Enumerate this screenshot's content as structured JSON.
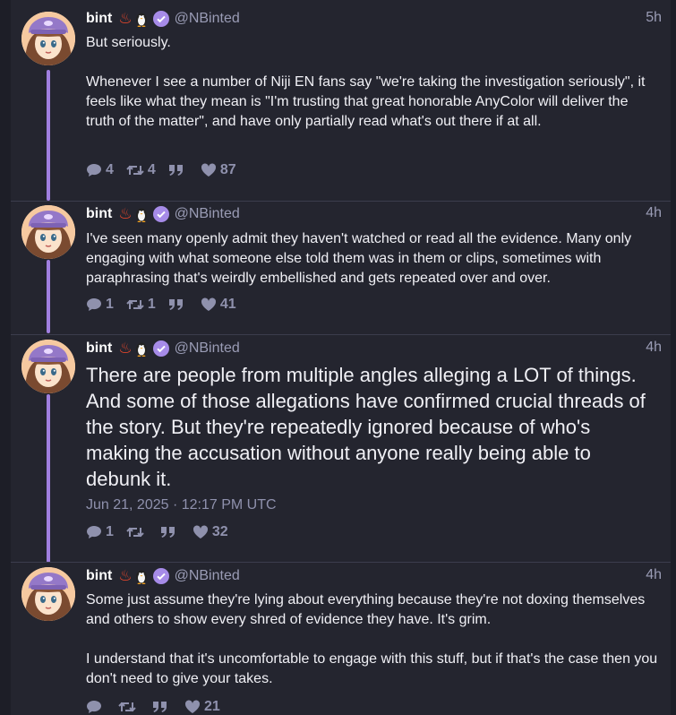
{
  "tweets": [
    {
      "name": "bint",
      "handle": "@NBinted",
      "time": "5h",
      "paragraphs": [
        "But seriously.",
        "Whenever I see a number of Niji EN fans say \"we're taking the investigation seriously\", it feels like what they mean is \"I'm trusting that great honorable AnyColor will deliver the truth of the matter\", and have only partially read what's out there if at all."
      ],
      "replies": "4",
      "retweets": "4",
      "quotes": "",
      "likes": "87"
    },
    {
      "name": "bint",
      "handle": "@NBinted",
      "time": "4h",
      "paragraphs": [
        "I've seen many openly admit they haven't watched or read all the evidence. Many only engaging with what someone else told them was in them or clips, sometimes with paraphrasing that's weirdly embellished and gets repeated over and over."
      ],
      "replies": "1",
      "retweets": "1",
      "quotes": "",
      "likes": "41"
    },
    {
      "name": "bint",
      "handle": "@NBinted",
      "time": "4h",
      "paragraphs": [
        "There are people from multiple angles alleging a LOT of things. And some of those allegations have confirmed crucial threads of the story. But they're repeatedly ignored because of who's making the accusation without anyone really being able to debunk it."
      ],
      "date": "Jun 21, 2025 · 12:17 PM UTC",
      "replies": "1",
      "retweets": "",
      "quotes": "",
      "likes": "32"
    },
    {
      "name": "bint",
      "handle": "@NBinted",
      "time": "4h",
      "paragraphs": [
        "Some just assume they're lying about everything because they're not doxing themselves and others to show every shred of evidence they have.  It's grim.",
        "I understand that it's uncomfortable to engage with this stuff, but if that's the case then you don't need to give your takes."
      ],
      "replies": "",
      "retweets": "",
      "quotes": "",
      "likes": "21"
    }
  ],
  "colors": {
    "background": "#24252f",
    "thread_line": "#a07fe0",
    "verified": "#a68be8",
    "muted_text": "#9a9cb5"
  }
}
